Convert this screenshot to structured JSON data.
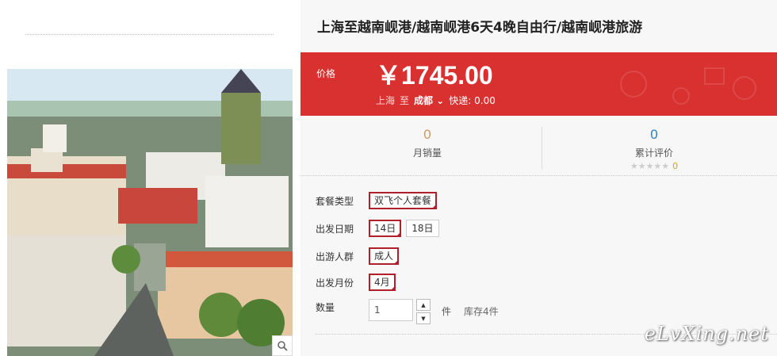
{
  "title": "上海至越南岘港/越南岘港6天4晚自由行/越南岘港旅游",
  "price": {
    "label": "价格",
    "value": "￥1745.00"
  },
  "route": {
    "from": "上海",
    "to": "至",
    "destination": "成都",
    "express": "快递: 0.00"
  },
  "stats": {
    "monthly_sales": {
      "value": "0",
      "label": "月销量"
    },
    "reviews": {
      "value": "0",
      "label": "累计评价",
      "score": "0"
    }
  },
  "options": {
    "package": {
      "label": "套餐类型",
      "choices": [
        "双飞个人套餐"
      ]
    },
    "depart_date": {
      "label": "出发日期",
      "choices": [
        "14日",
        "18日"
      ]
    },
    "travelers": {
      "label": "出游人群",
      "choices": [
        "成人"
      ]
    },
    "depart_month": {
      "label": "出发月份",
      "choices": [
        "4月"
      ]
    }
  },
  "quantity": {
    "label": "数量",
    "value": "1",
    "unit": "件",
    "stock": "库存4件"
  },
  "watermark": "eLvXing.net",
  "colors": {
    "price_panel": "#d93030",
    "selected_border": "#b1202a",
    "sales_num": "#cc9966",
    "review_num": "#2b7dc9"
  }
}
